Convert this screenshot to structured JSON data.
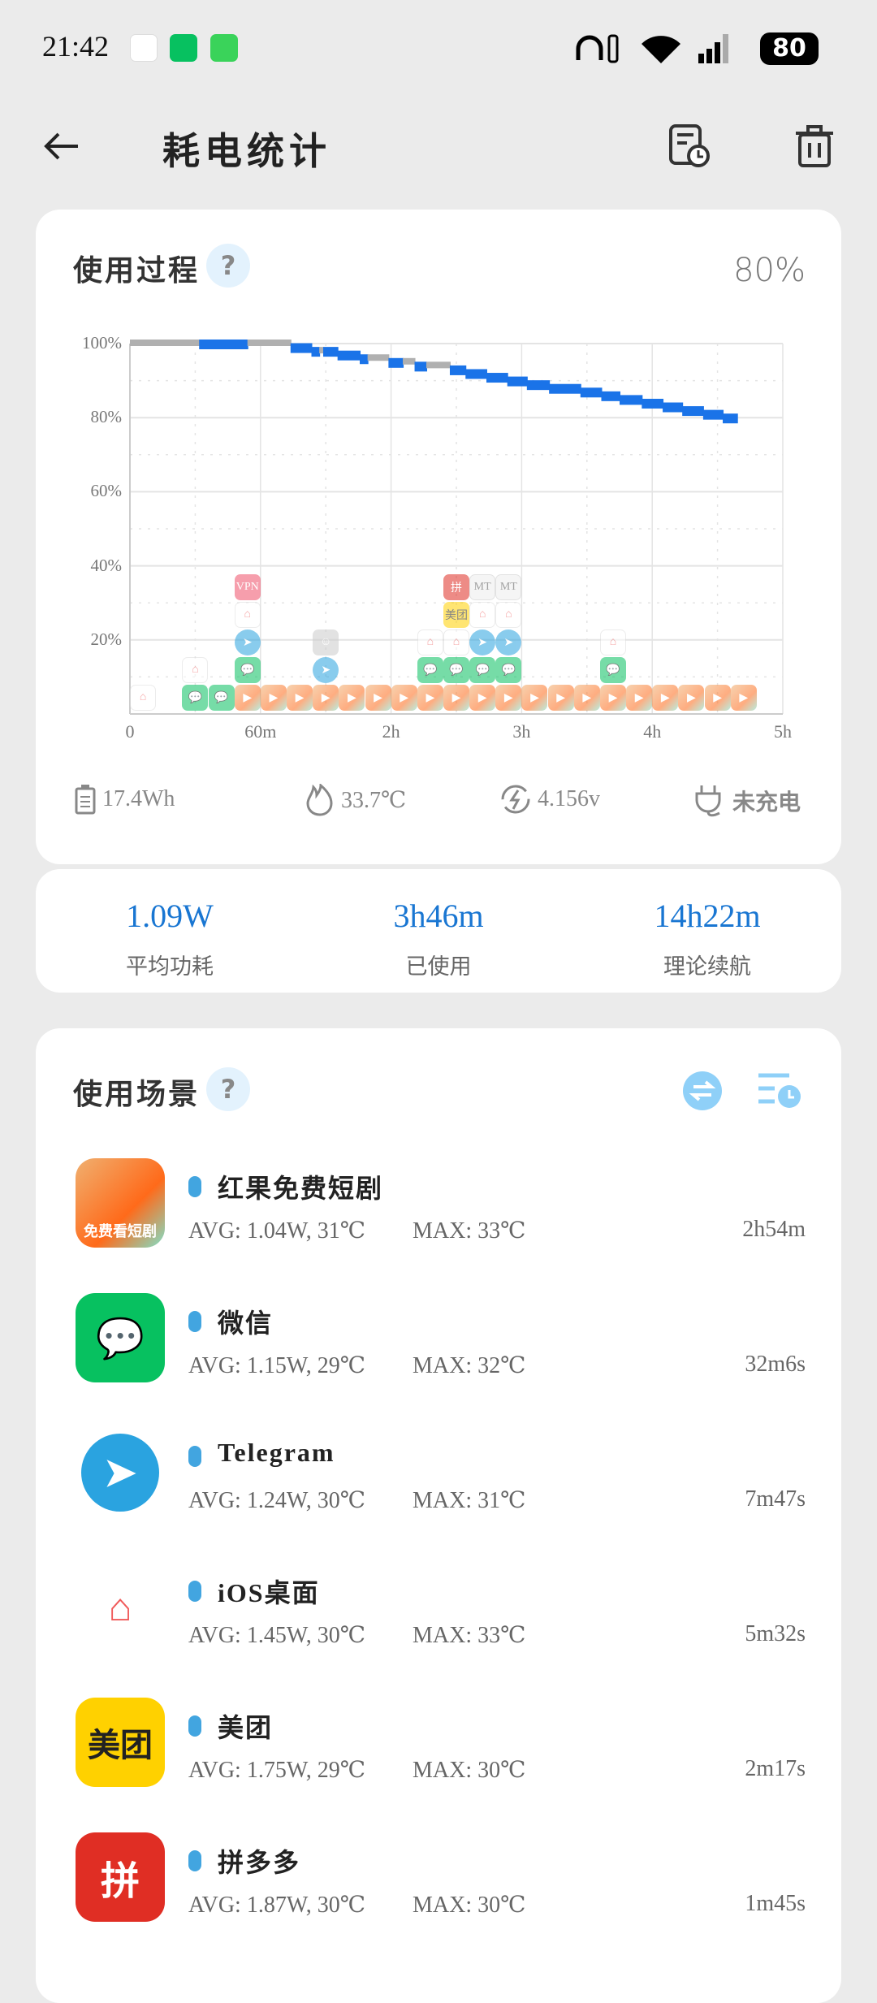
{
  "status_bar": {
    "time": "21:42",
    "battery": "80"
  },
  "header": {
    "title": "耗电统计"
  },
  "usage_card": {
    "title": "使用过程",
    "help": "?",
    "current_level": "80%",
    "stats": {
      "capacity": "17.4Wh",
      "temperature": "33.7℃",
      "voltage": "4.156v",
      "charging": "未充电"
    }
  },
  "chart_data": {
    "type": "line",
    "xlim": [
      0,
      5
    ],
    "ylim": [
      0,
      100
    ],
    "x_ticks": [
      {
        "v": 0,
        "label": "0"
      },
      {
        "v": 1,
        "label": "60m"
      },
      {
        "v": 2,
        "label": "2h"
      },
      {
        "v": 3,
        "label": "3h"
      },
      {
        "v": 4,
        "label": "4h"
      },
      {
        "v": 5,
        "label": "5h"
      }
    ],
    "y_ticks": [
      {
        "v": 100,
        "label": "100%"
      },
      {
        "v": 80,
        "label": "80%"
      },
      {
        "v": 60,
        "label": "60%"
      },
      {
        "v": 40,
        "label": "40%"
      },
      {
        "v": 20,
        "label": "20%"
      }
    ],
    "grid": true,
    "colors": {
      "screen_on": "#1a73e8",
      "screen_off": "#b0b0b0"
    },
    "battery_segments": [
      [
        0,
        0.53,
        100,
        "off"
      ],
      [
        0.53,
        0.9,
        100,
        "on"
      ],
      [
        0.9,
        1.23,
        100,
        "off"
      ],
      [
        1.23,
        1.39,
        99,
        "on"
      ],
      [
        1.39,
        1.45,
        98,
        "on"
      ],
      [
        1.45,
        1.48,
        98,
        "off"
      ],
      [
        1.48,
        1.59,
        98,
        "on"
      ],
      [
        1.59,
        1.76,
        97,
        "on"
      ],
      [
        1.76,
        1.82,
        96,
        "on"
      ],
      [
        1.82,
        1.98,
        96,
        "off"
      ],
      [
        1.98,
        2.09,
        95,
        "on"
      ],
      [
        2.09,
        2.18,
        95,
        "off"
      ],
      [
        2.18,
        2.27,
        94,
        "on"
      ],
      [
        2.27,
        2.45,
        94,
        "off"
      ],
      [
        2.45,
        2.57,
        93,
        "on"
      ],
      [
        2.57,
        2.73,
        92,
        "on"
      ],
      [
        2.73,
        2.89,
        91,
        "on"
      ],
      [
        2.89,
        3.04,
        90,
        "on"
      ],
      [
        3.04,
        3.21,
        89,
        "on"
      ],
      [
        3.21,
        3.45,
        88,
        "on"
      ],
      [
        3.45,
        3.61,
        87,
        "on"
      ],
      [
        3.61,
        3.75,
        86,
        "on"
      ],
      [
        3.75,
        3.92,
        85,
        "on"
      ],
      [
        3.92,
        4.08,
        84,
        "on"
      ],
      [
        4.08,
        4.23,
        83,
        "on"
      ],
      [
        4.23,
        4.39,
        82,
        "on"
      ],
      [
        4.39,
        4.54,
        81,
        "on"
      ],
      [
        4.54,
        4.65,
        80,
        "on"
      ]
    ],
    "app_slots": [
      {
        "t": 0.1,
        "apps": [
          "home"
        ]
      },
      {
        "t": 0.5,
        "apps": [
          "wechat",
          "home"
        ]
      },
      {
        "t": 0.7,
        "apps": [
          "wechat"
        ]
      },
      {
        "t": 0.9,
        "apps": [
          "hongguo",
          "wechat",
          "telegram",
          "home",
          "vpn"
        ]
      },
      {
        "t": 1.1,
        "apps": [
          "hongguo"
        ]
      },
      {
        "t": 1.3,
        "apps": [
          "hongguo"
        ]
      },
      {
        "t": 1.5,
        "apps": [
          "hongguo",
          "telegram",
          "contacts"
        ]
      },
      {
        "t": 1.7,
        "apps": [
          "hongguo"
        ]
      },
      {
        "t": 1.9,
        "apps": [
          "hongguo"
        ]
      },
      {
        "t": 2.1,
        "apps": [
          "hongguo"
        ]
      },
      {
        "t": 2.3,
        "apps": [
          "hongguo",
          "wechat",
          "home"
        ]
      },
      {
        "t": 2.5,
        "apps": [
          "hongguo",
          "wechat",
          "home",
          "meituan",
          "pinduoduo"
        ]
      },
      {
        "t": 2.7,
        "apps": [
          "hongguo",
          "wechat",
          "telegram",
          "home",
          "mt"
        ]
      },
      {
        "t": 2.9,
        "apps": [
          "hongguo",
          "wechat",
          "telegram",
          "home",
          "mt"
        ]
      },
      {
        "t": 3.1,
        "apps": [
          "hongguo"
        ]
      },
      {
        "t": 3.3,
        "apps": [
          "hongguo"
        ]
      },
      {
        "t": 3.5,
        "apps": [
          "hongguo"
        ]
      },
      {
        "t": 3.7,
        "apps": [
          "hongguo",
          "wechat",
          "home"
        ]
      },
      {
        "t": 3.9,
        "apps": [
          "hongguo"
        ]
      },
      {
        "t": 4.1,
        "apps": [
          "hongguo"
        ]
      },
      {
        "t": 4.3,
        "apps": [
          "hongguo"
        ]
      },
      {
        "t": 4.5,
        "apps": [
          "hongguo"
        ]
      },
      {
        "t": 4.7,
        "apps": [
          "hongguo"
        ]
      }
    ]
  },
  "summary": {
    "avg_power": "1.09W",
    "avg_power_label": "平均功耗",
    "used": "3h46m",
    "used_label": "已使用",
    "remaining": "14h22m",
    "remaining_label": "理论续航"
  },
  "scenes": {
    "title": "使用场景",
    "help": "?",
    "apps": [
      {
        "name": "红果免费短剧",
        "icon": "hongguo",
        "badge": "免费看短剧",
        "avg": "AVG: 1.04W, 31℃",
        "max": "MAX:  33℃",
        "duration": "2h54m"
      },
      {
        "name": "微信",
        "icon": "wechat",
        "avg": "AVG: 1.15W, 29℃",
        "max": "MAX:  32℃",
        "duration": "32m6s"
      },
      {
        "name": "Telegram",
        "icon": "telegram",
        "avg": "AVG: 1.24W, 30℃",
        "max": "MAX:  31℃",
        "duration": "7m47s"
      },
      {
        "name": "iOS桌面",
        "icon": "home",
        "avg": "AVG: 1.45W, 30℃",
        "max": "MAX:  33℃",
        "duration": "5m32s"
      },
      {
        "name": "美团",
        "icon": "meituan",
        "badge": "美团",
        "avg": "AVG: 1.75W, 29℃",
        "max": "MAX:  30℃",
        "duration": "2m17s"
      },
      {
        "name": "拼多多",
        "icon": "pinduoduo",
        "avg": "AVG: 1.87W, 30℃",
        "max": "MAX:  30℃",
        "duration": "1m45s"
      }
    ]
  }
}
